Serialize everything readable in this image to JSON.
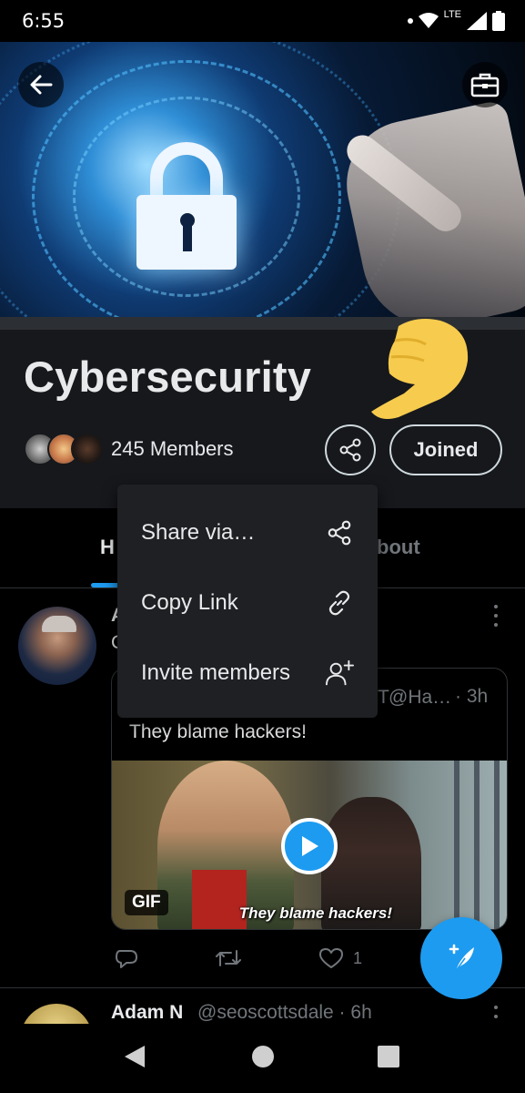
{
  "status_bar": {
    "time": "6:55",
    "network": "LTE"
  },
  "banner": {
    "back_icon": "arrow-left-icon",
    "tools_icon": "briefcase-icon"
  },
  "community": {
    "title": "Cybersecurity",
    "members_label": "245 Members",
    "share_icon": "share-icon",
    "joined_label": "Joined"
  },
  "tabs": {
    "home_partial": "H",
    "about_partial": "bout",
    "indicator_color": "#1d9bf0"
  },
  "menu": {
    "items": [
      {
        "label": "Share via…",
        "icon": "share-icon"
      },
      {
        "label": "Copy Link",
        "icon": "link-icon"
      },
      {
        "label": "Invite members",
        "icon": "add-person-icon"
      }
    ]
  },
  "tweet": {
    "name_partial": "A",
    "text_partial": "C",
    "quote": {
      "handle": "@Ha…",
      "partial_name": "T",
      "time": "· 3h",
      "text": "They blame hackers!",
      "gif_badge": "GIF",
      "subtitle": "They blame hackers!"
    },
    "actions": {
      "reply_icon": "reply-icon",
      "retweet_icon": "retweet-icon",
      "like_icon": "heart-icon",
      "like_count": "1"
    }
  },
  "next_tweet": {
    "name": "Adam N",
    "handle": "@seoscottsdale · 6h"
  },
  "fab": {
    "icon": "compose-icon",
    "color": "#1d9bf0"
  },
  "nav": {
    "back_icon": "back-triangle-icon",
    "home_icon": "home-circle-icon",
    "recents_icon": "recents-square-icon"
  }
}
